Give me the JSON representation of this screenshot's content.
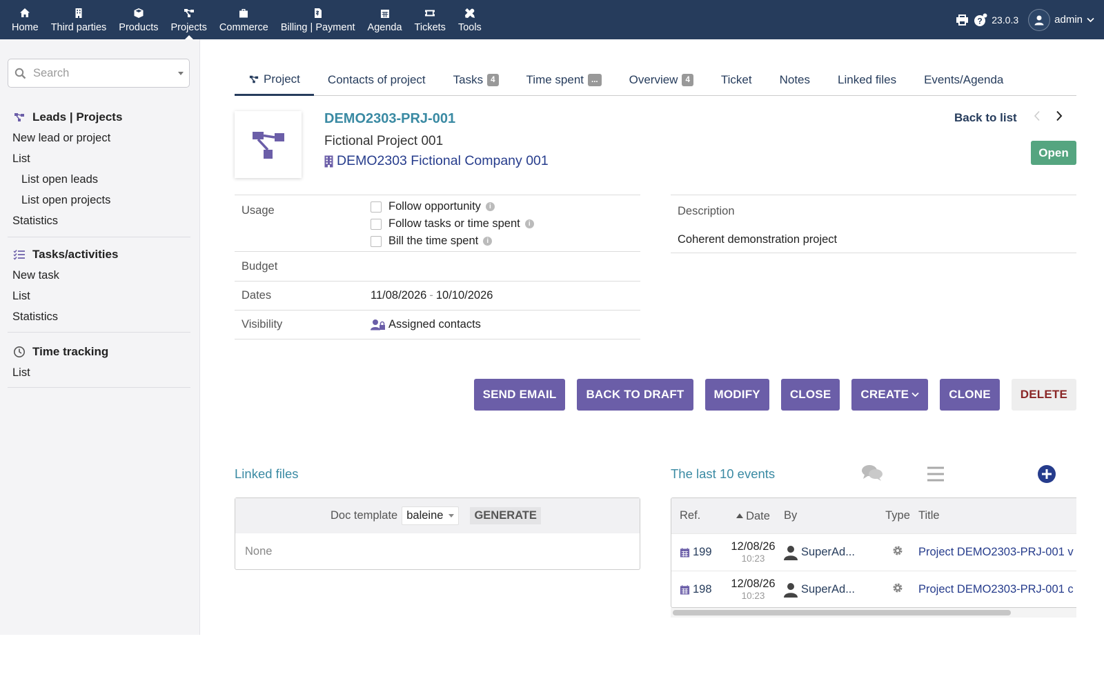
{
  "topnav": {
    "items": [
      {
        "label": "Home",
        "icon": "home-icon"
      },
      {
        "label": "Third parties",
        "icon": "building-icon"
      },
      {
        "label": "Products",
        "icon": "box-icon"
      },
      {
        "label": "Projects",
        "icon": "project-icon"
      },
      {
        "label": "Commerce",
        "icon": "briefcase-icon"
      },
      {
        "label": "Billing | Payment",
        "icon": "invoice-icon"
      },
      {
        "label": "Agenda",
        "icon": "calendar-icon"
      },
      {
        "label": "Tickets",
        "icon": "ticket-icon"
      },
      {
        "label": "Tools",
        "icon": "tools-icon"
      }
    ],
    "version": "23.0.3",
    "username": "admin"
  },
  "sidebar": {
    "search_placeholder": "Search",
    "projects": {
      "title": "Leads | Projects",
      "items": [
        "New lead or project",
        "List",
        "List open leads",
        "List open projects",
        "Statistics"
      ]
    },
    "tasks": {
      "title": "Tasks/activities",
      "items": [
        "New task",
        "List",
        "Statistics"
      ]
    },
    "time": {
      "title": "Time tracking",
      "items": [
        "List"
      ]
    }
  },
  "tabs": [
    {
      "label": "Project",
      "badge": ""
    },
    {
      "label": "Contacts of project",
      "badge": ""
    },
    {
      "label": "Tasks",
      "badge": "4"
    },
    {
      "label": "Time spent",
      "badge": "..."
    },
    {
      "label": "Overview",
      "badge": "4"
    },
    {
      "label": "Ticket",
      "badge": ""
    },
    {
      "label": "Notes",
      "badge": ""
    },
    {
      "label": "Linked files",
      "badge": ""
    },
    {
      "label": "Events/Agenda",
      "badge": ""
    }
  ],
  "project": {
    "ref": "DEMO2303-PRJ-001",
    "label": "Fictional Project 001",
    "company": "DEMO2303 Fictional Company 001",
    "back_to_list": "Back to list",
    "status": "Open",
    "status_color": "#55a580"
  },
  "fields": {
    "usage_label": "Usage",
    "usage_options": [
      "Follow opportunity",
      "Follow tasks or time spent",
      "Bill the time spent"
    ],
    "budget_label": "Budget",
    "budget_value": "",
    "dates_label": "Dates",
    "date_start": "11/08/2026",
    "date_sep": "-",
    "date_end": "10/10/2026",
    "visibility_label": "Visibility",
    "visibility_value": "Assigned contacts",
    "description_label": "Description",
    "description_value": "Coherent demonstration project"
  },
  "actions": {
    "send_email": "SEND EMAIL",
    "back_to_draft": "BACK TO DRAFT",
    "modify": "MODIFY",
    "close": "CLOSE",
    "create": "CREATE",
    "clone": "CLONE",
    "delete": "DELETE",
    "accent": "#6b5ea8"
  },
  "linked_files": {
    "title": "Linked files",
    "doc_template_label": "Doc template",
    "doc_template_value": "baleine",
    "generate_label": "GENERATE",
    "empty_text": "None"
  },
  "events": {
    "title": "The last 10 events",
    "columns": {
      "ref": "Ref.",
      "date": "Date",
      "by": "By",
      "type": "Type",
      "title": "Title"
    },
    "rows": [
      {
        "ref": "199",
        "date": "12/08/26",
        "time": "10:23",
        "by": "SuperAd...",
        "title": "Project DEMO2303-PRJ-001 v"
      },
      {
        "ref": "198",
        "date": "12/08/26",
        "time": "10:23",
        "by": "SuperAd...",
        "title": "Project DEMO2303-PRJ-001 c"
      }
    ]
  }
}
